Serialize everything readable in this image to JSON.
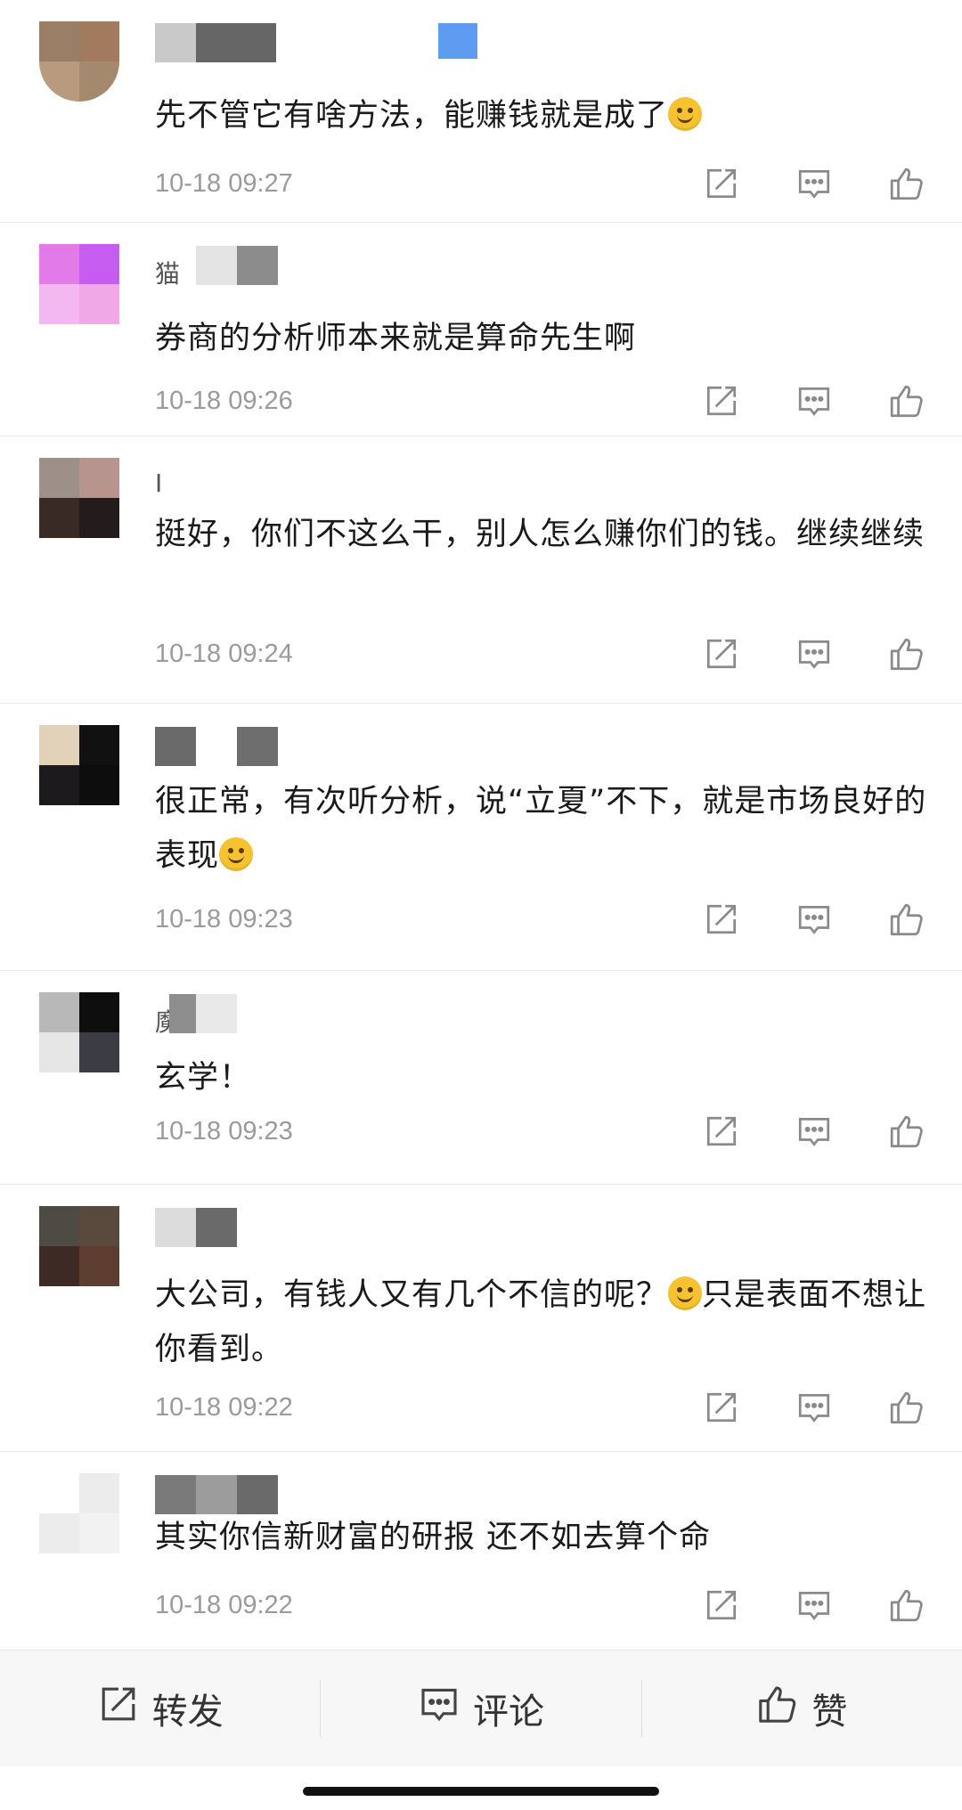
{
  "comments": [
    {
      "avatar_colors": [
        "#9b7e66",
        "#a27b5e",
        "#b89a7e",
        "#a4896e"
      ],
      "username_initial": "",
      "name_blocks": [
        "#c9c9c9",
        "#666666",
        "#ffffff",
        "#5e9cf2"
      ],
      "text": "先不管它有啥方法，能赚钱就是成了",
      "emoji": "laugh-cry-emoji",
      "time": "10-18 09:27"
    },
    {
      "avatar_colors": [
        "#e07be8",
        "#c65cf0",
        "#f3b8ef",
        "#f0a8e6"
      ],
      "username_initial": "猫",
      "name_blocks": [
        "#e4e4e4",
        "#8c8c8c"
      ],
      "text": "券商的分析师本来就是算命先生啊",
      "emoji": "",
      "time": "10-18 09:26"
    },
    {
      "avatar_colors": [
        "#9d9089",
        "#b8948f",
        "#3a2a26",
        "#241b1d"
      ],
      "username_initial": "I",
      "name_blocks": [],
      "text": "挺好，你们不这么干，别人怎么赚你们的钱。继续继续",
      "emoji": "",
      "time": "10-18 09:24"
    },
    {
      "avatar_colors": [
        "#e2d2ba",
        "#111111",
        "#1c1a1c",
        "#0d0d0d"
      ],
      "username_initial": "",
      "name_blocks": [
        "#6a6a6a",
        "#ffffff",
        "#6e6e6e"
      ],
      "text": "很正常，有次听分析，说“立夏”不下，就是市场良好的表现",
      "emoji": "laugh-cry-emoji",
      "time": "10-18 09:23"
    },
    {
      "avatar_colors": [
        "#b8b8b8",
        "#0e0e0e",
        "#e6e6e6",
        "#3c3c44"
      ],
      "username_initial": "魔",
      "name_blocks": [
        "#8e8e8e",
        "#e9e9e9",
        "#3c3c3c"
      ],
      "text": "玄学！",
      "emoji": "",
      "time": "10-18 09:23"
    },
    {
      "avatar_colors": [
        "#4e4a44",
        "#5a4a3e",
        "#3e2a24",
        "#5c3d30"
      ],
      "username_initial": "",
      "name_blocks": [
        "#dcdcdc",
        "#6a6a6a"
      ],
      "text_before_emoji": "大公司，有钱人又有几个不信的呢？",
      "text": "只是表面不想让你看到。",
      "emoji": "smile-emoji",
      "time": "10-18 09:22"
    },
    {
      "avatar_colors": [
        "#ffffff",
        "#ececec",
        "#ececec",
        "#f2f2f2"
      ],
      "username_initial": "",
      "name_blocks": [
        "#7a7a7a",
        "#9c9c9c",
        "#6a6a6a"
      ],
      "text": "其实你信新财富的研报 还不如去算个命",
      "emoji": "",
      "time": "10-18 09:22"
    }
  ],
  "bottom_bar": {
    "repost_label": "转发",
    "comment_label": "评论",
    "like_label": "赞"
  },
  "icons": {
    "repost": "repost-icon",
    "comment": "comment-icon",
    "like": "thumbs-up-icon"
  }
}
